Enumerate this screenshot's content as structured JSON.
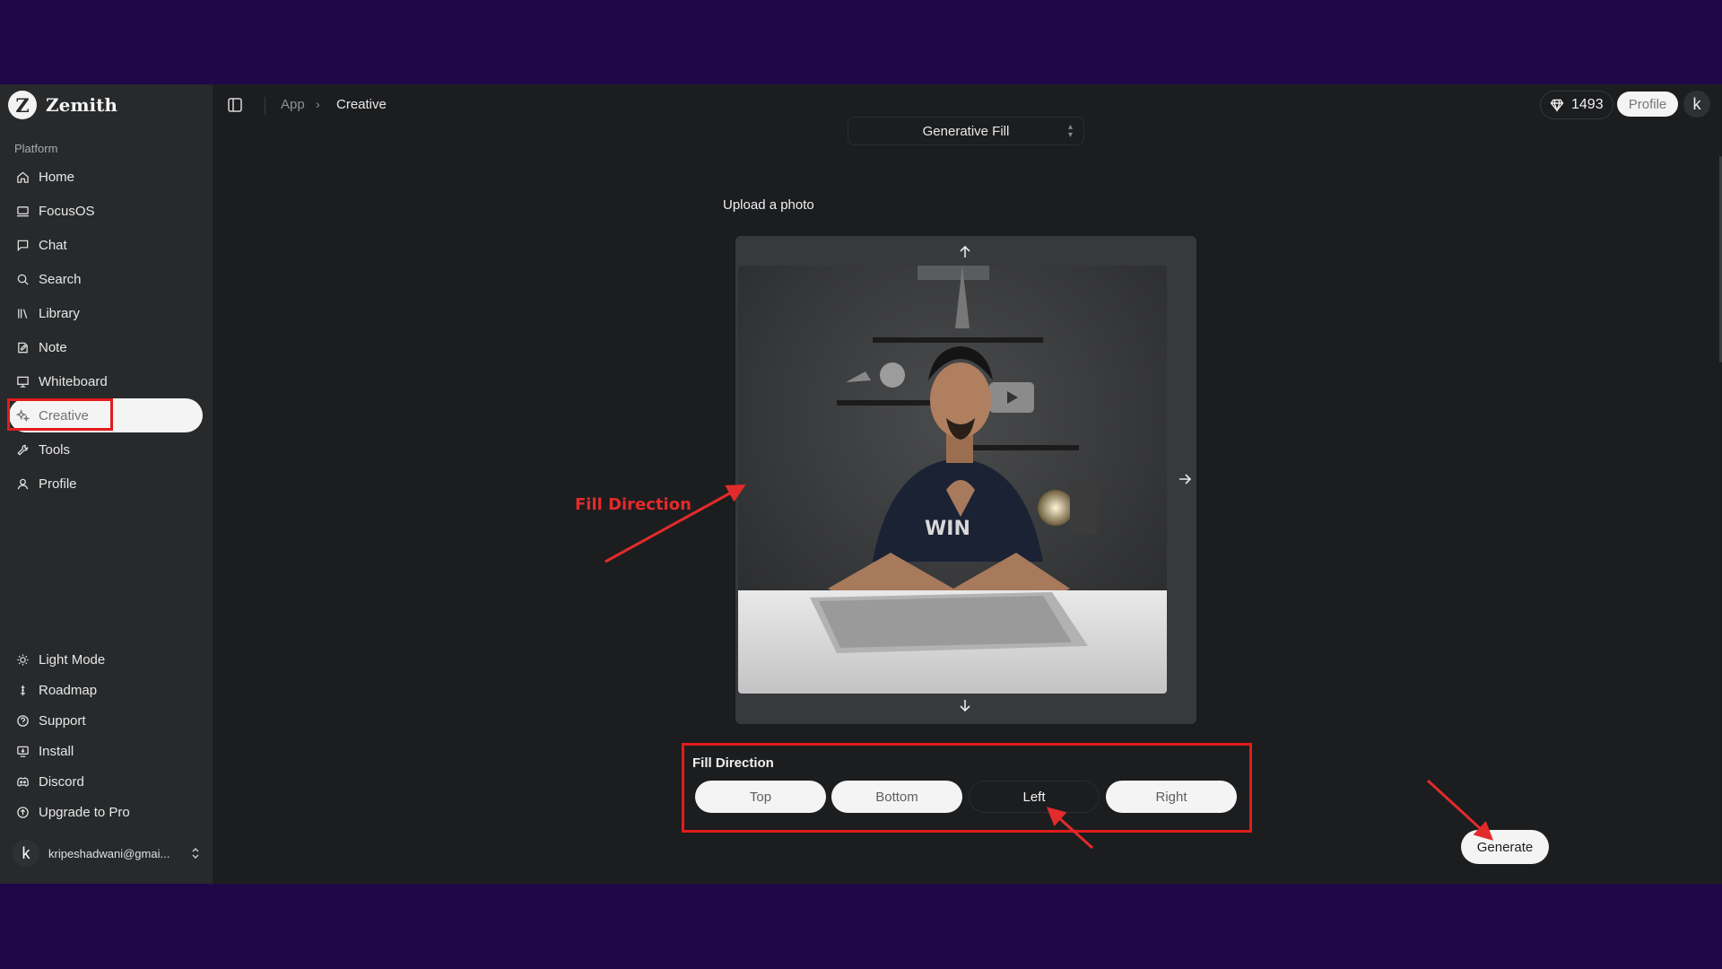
{
  "app": {
    "name": "Zemith",
    "logo_letter": "Z"
  },
  "sidebar": {
    "section_label": "Platform",
    "items": [
      {
        "label": "Home",
        "icon": "home-icon"
      },
      {
        "label": "FocusOS",
        "icon": "monitor-icon"
      },
      {
        "label": "Chat",
        "icon": "chat-icon"
      },
      {
        "label": "Search",
        "icon": "search-icon"
      },
      {
        "label": "Library",
        "icon": "library-icon"
      },
      {
        "label": "Note",
        "icon": "note-icon"
      },
      {
        "label": "Whiteboard",
        "icon": "whiteboard-icon"
      },
      {
        "label": "Creative",
        "icon": "sparkles-icon",
        "active": true
      },
      {
        "label": "Tools",
        "icon": "wrench-icon"
      },
      {
        "label": "Profile",
        "icon": "user-icon"
      }
    ],
    "bottom_items": [
      {
        "label": "Light Mode",
        "icon": "sun-icon"
      },
      {
        "label": "Roadmap",
        "icon": "roadmap-icon"
      },
      {
        "label": "Support",
        "icon": "help-icon"
      },
      {
        "label": "Install",
        "icon": "install-icon"
      },
      {
        "label": "Discord",
        "icon": "discord-icon"
      },
      {
        "label": "Upgrade to Pro",
        "icon": "upgrade-icon"
      }
    ],
    "account": {
      "avatar_letter": "k",
      "email": "kripeshadwani@gmai..."
    }
  },
  "header": {
    "breadcrumb": [
      "App",
      "Creative"
    ],
    "credits": "1493",
    "profile_label": "Profile",
    "avatar_letter": "k"
  },
  "creative": {
    "mode": "Generative Fill",
    "upload_label": "Upload a photo",
    "fill_direction_title": "Fill Direction",
    "directions": [
      "Top",
      "Bottom",
      "Left",
      "Right"
    ],
    "selected_direction": "Left",
    "generate_label": "Generate"
  },
  "annotation": {
    "text": "Fill Direction",
    "color": "#e22b2b"
  },
  "colors": {
    "frame": "#1e0848",
    "sidebar": "#27292b",
    "main": "#1c1d1f",
    "highlight": "#e21c1c"
  }
}
